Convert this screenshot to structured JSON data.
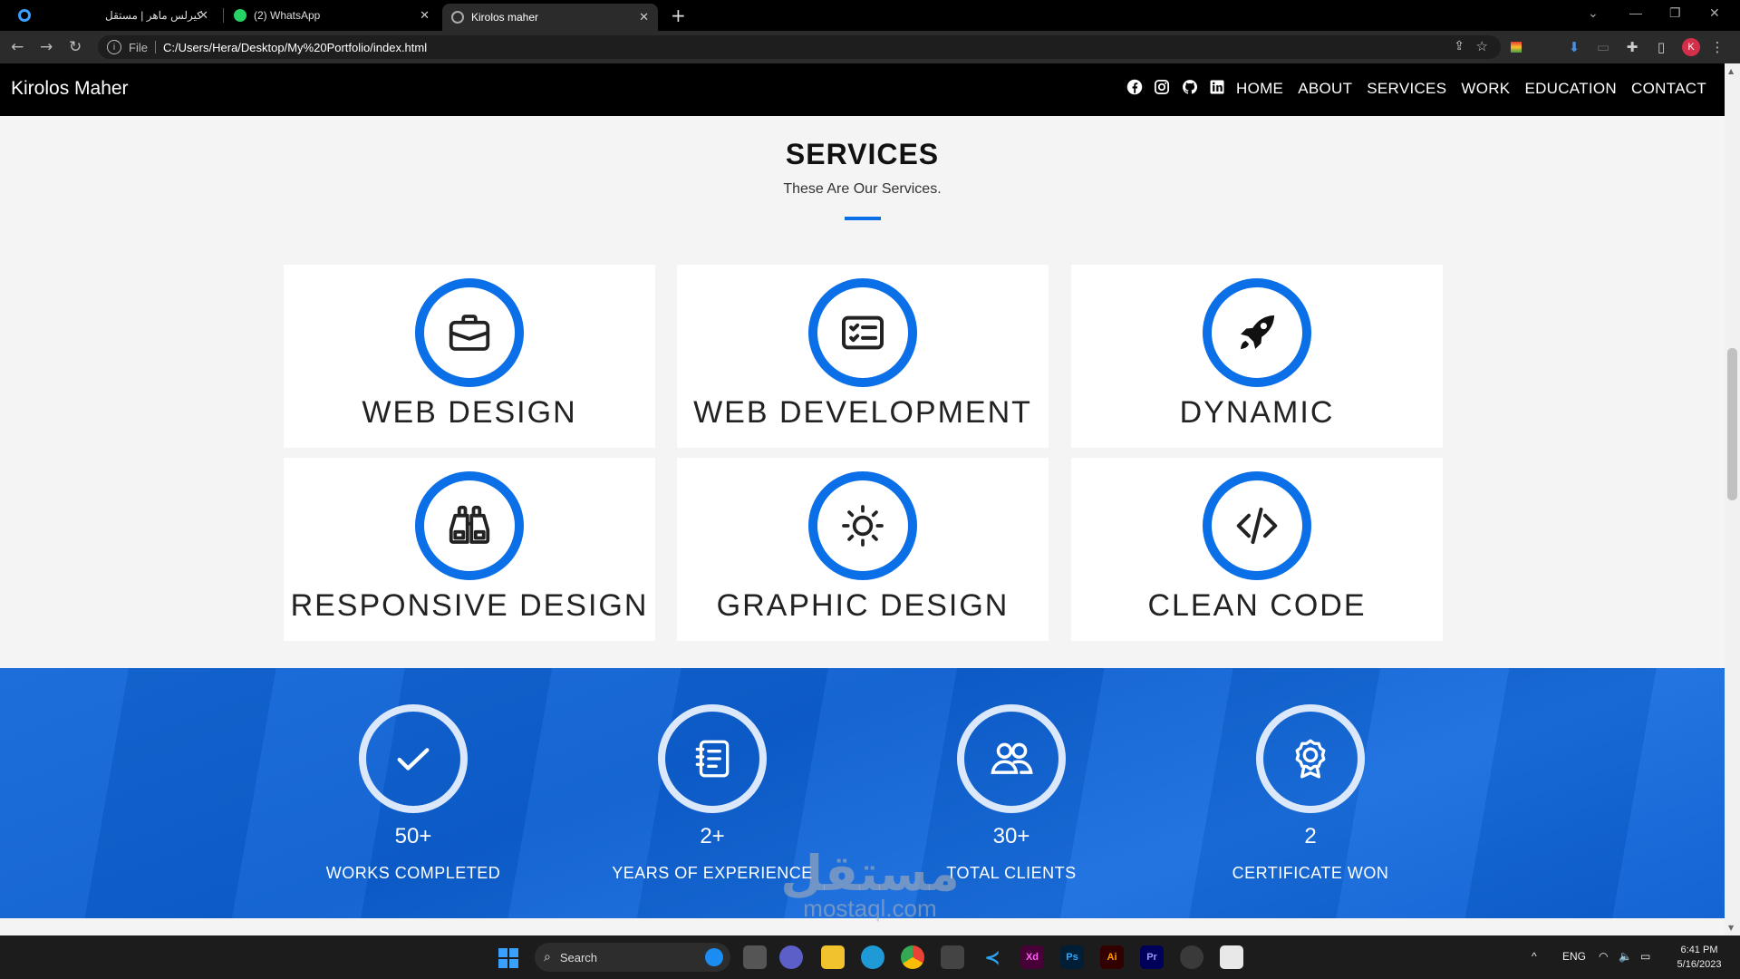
{
  "browser": {
    "tabs": [
      {
        "title": "كيرلس ماهر | مستقل",
        "active": false
      },
      {
        "title": "(2) WhatsApp",
        "active": false
      },
      {
        "title": "Kirolos maher",
        "active": true
      }
    ],
    "new_tab_icon": "plus-icon",
    "omnibox": {
      "scheme_label": "File",
      "url": "C:/Users/Hera/Desktop/My%20Portfolio/index.html"
    },
    "profile_initial": "K",
    "colors": {
      "tabbar": "#000000",
      "toolbar": "#2b2b2b",
      "profile": "#d42f48"
    }
  },
  "site": {
    "brand": "Kirolos Maher",
    "social_icons": [
      "facebook-icon",
      "instagram-icon",
      "github-icon",
      "linkedin-icon"
    ],
    "nav": [
      "HOME",
      "ABOUT",
      "SERVICES",
      "WORK",
      "EDUCATION",
      "CONTACT"
    ],
    "services": {
      "title": "SERVICES",
      "subtitle": "These Are Our Services.",
      "items": [
        {
          "label": "WEB DESIGN",
          "icon": "briefcase-icon"
        },
        {
          "label": "WEB DEVELOPMENT",
          "icon": "checklist-icon"
        },
        {
          "label": "DYNAMIC",
          "icon": "rocket-icon"
        },
        {
          "label": "RESPONSIVE DESIGN",
          "icon": "binoculars-icon"
        },
        {
          "label": "GRAPHIC DESIGN",
          "icon": "sun-icon"
        },
        {
          "label": "CLEAN CODE",
          "icon": "code-icon"
        }
      ]
    },
    "stats": [
      {
        "value": "50+",
        "caption": "WORKS COMPLETED",
        "icon": "check-icon"
      },
      {
        "value": "2+",
        "caption": "YEARS OF EXPERIENCE",
        "icon": "journal-icon"
      },
      {
        "value": "30+",
        "caption": "TOTAL CLIENTS",
        "icon": "people-icon"
      },
      {
        "value": "2",
        "caption": "CERTIFICATE WON",
        "icon": "award-icon"
      }
    ],
    "colors": {
      "accent": "#0b6fe8",
      "stats_band": "#0d5fd0",
      "navbar": "#000000"
    }
  },
  "watermark": {
    "arabic": "مستقل",
    "latin": "mostaql.com"
  },
  "taskbar": {
    "search_label": "Search",
    "apps": [
      {
        "name": "file-explorer",
        "label": ""
      },
      {
        "name": "edge",
        "label": ""
      },
      {
        "name": "chrome",
        "label": ""
      },
      {
        "name": "store",
        "label": ""
      },
      {
        "name": "vscode",
        "label": ""
      },
      {
        "name": "xd",
        "label": "Xd"
      },
      {
        "name": "photoshop",
        "label": "Ps"
      },
      {
        "name": "illustrator",
        "label": "Ai"
      },
      {
        "name": "premiere",
        "label": "Pr"
      }
    ],
    "language": "ENG",
    "time": "6:41 PM",
    "date": "5/16/2023"
  }
}
